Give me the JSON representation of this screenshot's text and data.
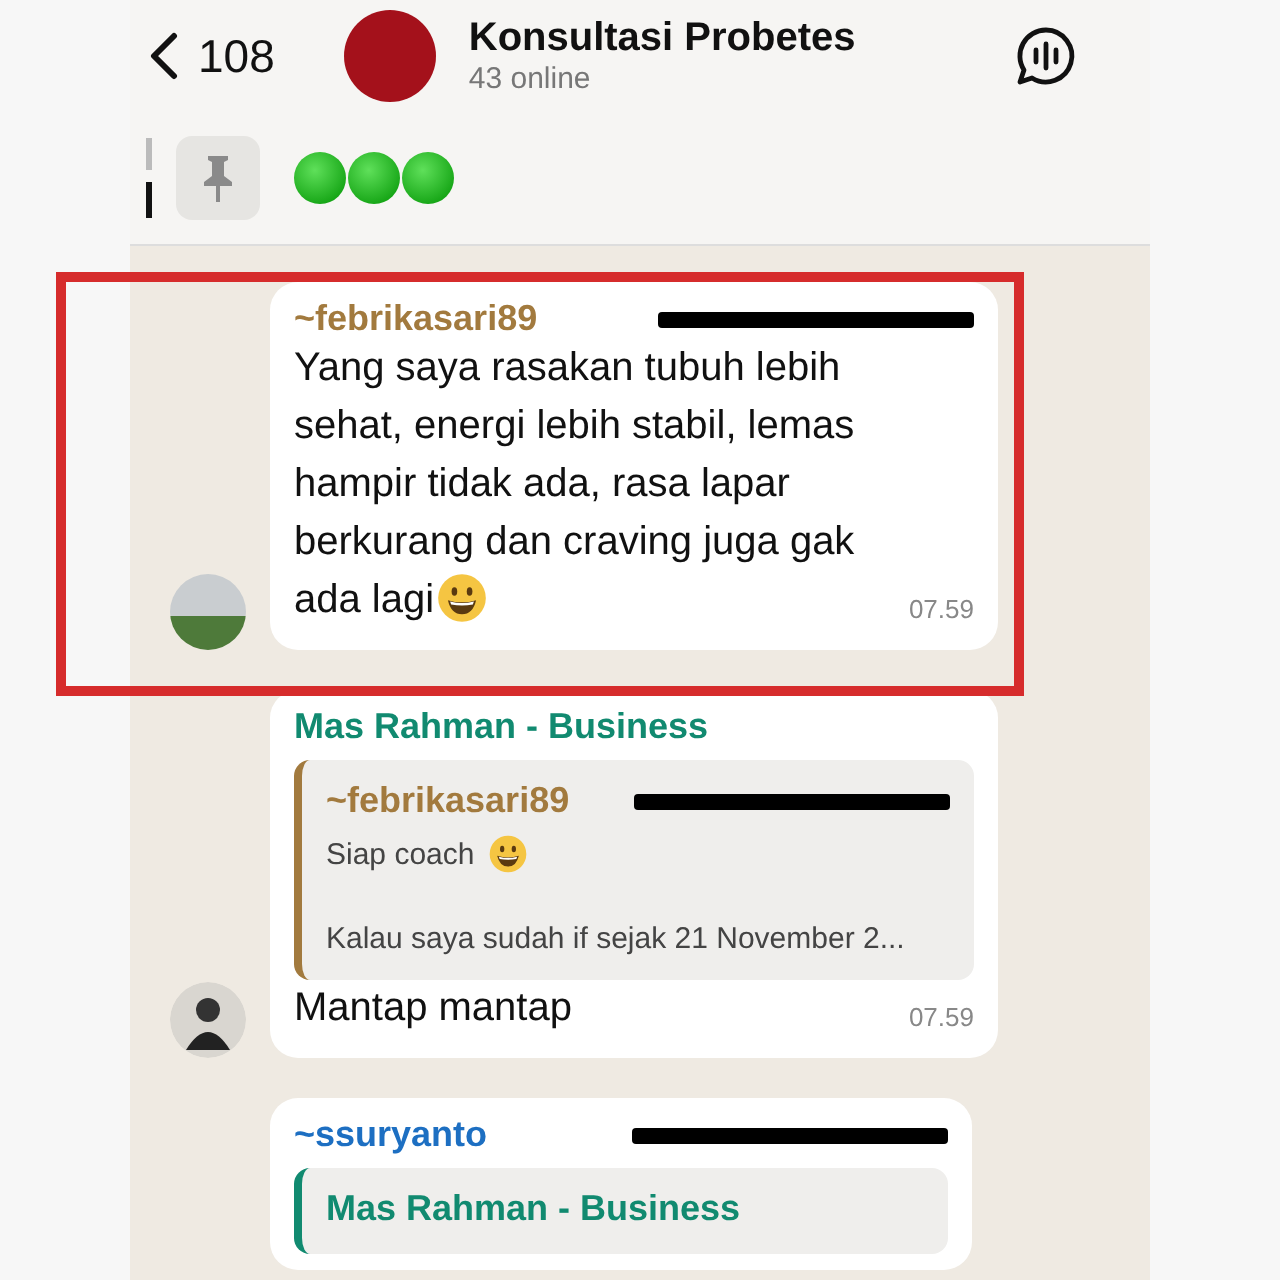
{
  "header": {
    "back_count": "108",
    "title": "Konsultasi Probetes",
    "subtitle": "43 online"
  },
  "pinned": {
    "marks": [
      {
        "kind": "dot"
      },
      {
        "kind": "dot"
      },
      {
        "kind": "dot"
      }
    ]
  },
  "highlight": {
    "shown": true
  },
  "messages": [
    {
      "sender": "~febrikasari89",
      "color": "#a27a3e",
      "redacted": true,
      "avatar": {
        "kind": "photo"
      },
      "text": "Yang saya rasakan tubuh lebih sehat, energi lebih stabil, lemas hampir tidak ada, rasa lapar berkurang dan craving juga gak ada lagi",
      "smiley": true,
      "time": "07.59"
    },
    {
      "sender": "Mas Rahman - Business",
      "color": "#118a70",
      "avatar": {
        "kind": "person"
      },
      "quote": {
        "sender": "~febrikasari89",
        "color": "#a27a3e",
        "redacted": true,
        "lines": [
          {
            "text": "Siap coach",
            "smiley": true
          },
          {
            "text": "Kalau saya sudah if sejak 21  November 2..."
          }
        ]
      },
      "text": "Mantap mantap",
      "time": "07.59"
    },
    {
      "sender": "~ssuryanto",
      "color": "#1d6fc2",
      "redacted": true,
      "quote": {
        "sender": "Mas Rahman - Business",
        "color": "#118a70"
      }
    }
  ]
}
